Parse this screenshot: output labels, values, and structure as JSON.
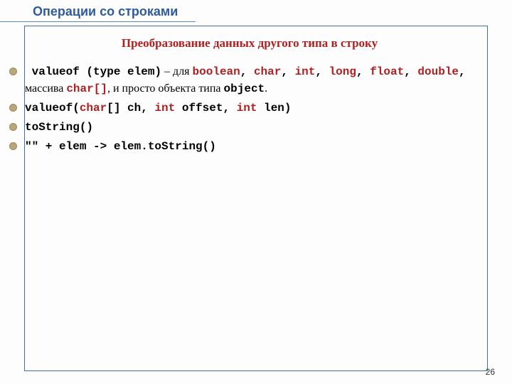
{
  "title": "Операции со строками",
  "subtitle": "Преобразование данных другого типа в строку",
  "page_number": "26",
  "b1": {
    "lead_space": " ",
    "sig": "valueof (type elem)",
    "dash_for": " – для ",
    "kw1": "boolean",
    "c1": ", ",
    "kw2": "char",
    "c2": ", ",
    "kw3": "int",
    "c3": ", ",
    "kw4": "long",
    "c4": ", ",
    "kw5": "float",
    "c5": ", ",
    "kw6": "double",
    "c6": ", ",
    "arr_text": " массива ",
    "arr_kw": "char[]",
    "obj_text": ", и просто объекта типа ",
    "obj_kw": "object",
    "period": "."
  },
  "b2": {
    "p1": "valueof(",
    "kw1": "char",
    "p2": "[] ch, ",
    "kw2": "int",
    "p3": " offset, ",
    "kw3": "int",
    "p4": " len)"
  },
  "b3": "toString()",
  "b4": "\"\" + elem -> elem.toString()"
}
